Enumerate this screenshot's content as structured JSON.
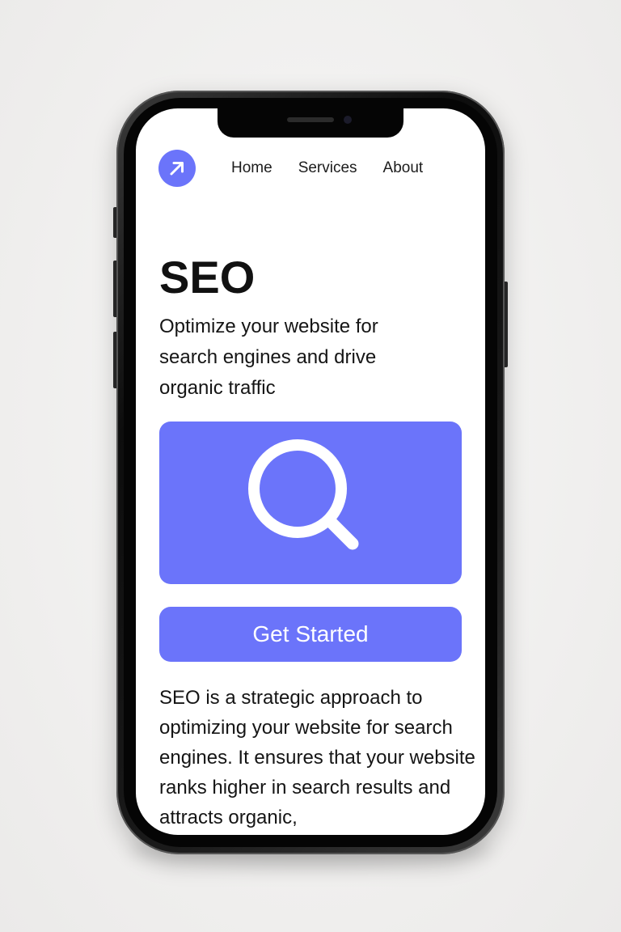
{
  "colors": {
    "accent": "#6b74fa",
    "text": "#151515",
    "background": "#ffffff"
  },
  "nav": {
    "logo_icon": "arrow-up-right-icon",
    "items": [
      {
        "label": "Home"
      },
      {
        "label": "Services"
      },
      {
        "label": "About"
      }
    ]
  },
  "hero": {
    "title": "SEO",
    "subtitle": "Optimize your website for search engines and drive organic traffic",
    "image_icon": "magnifying-glass-icon"
  },
  "cta": {
    "label": "Get Started"
  },
  "body": {
    "text": "SEO is a strategic approach to optimizing your website for search engines. It ensures that your website ranks higher in search results and attracts organic,"
  }
}
